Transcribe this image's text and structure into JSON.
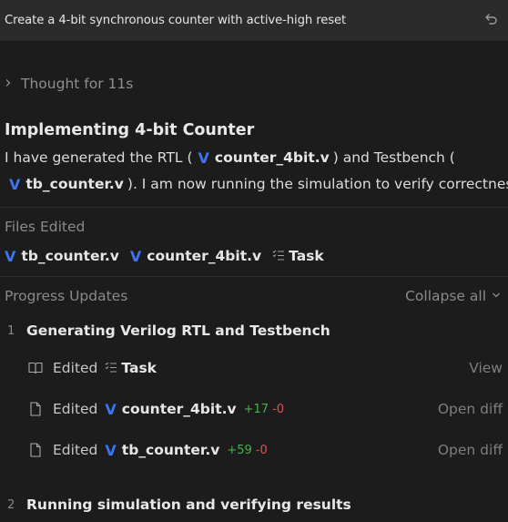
{
  "prompt": {
    "text": "Create a 4-bit synchronous counter with active-high reset"
  },
  "thought": {
    "label": "Thought for 11s"
  },
  "summary": {
    "title": "Implementing 4-bit Counter",
    "line1_prefix": "I have generated the RTL (",
    "line1_file": "counter_4bit.v",
    "line1_mid": ") and Testbench (",
    "line2_file": "tb_counter.v",
    "line2_suffix": "). I am now running the simulation to verify correctness."
  },
  "files_edited": {
    "title": "Files Edited",
    "items": [
      "tb_counter.v",
      "counter_4bit.v",
      "Task"
    ]
  },
  "progress": {
    "title": "Progress Updates",
    "collapse_label": "Collapse all",
    "steps": [
      {
        "number": "1",
        "label": "Generating Verilog RTL and Testbench",
        "actions": [
          {
            "verb": "Edited",
            "target": "Task",
            "link": "View"
          },
          {
            "verb": "Edited",
            "target": "counter_4bit.v",
            "added": "+17",
            "removed": "-0",
            "link": "Open diff"
          },
          {
            "verb": "Edited",
            "target": "tb_counter.v",
            "added": "+59",
            "removed": "-0",
            "link": "Open diff"
          }
        ]
      },
      {
        "number": "2",
        "label": "Running simulation and verifying results"
      }
    ]
  },
  "colors": {
    "background": "#1c1c1c",
    "prompt_bar": "#2b2b2b",
    "verilog_icon": "#3b76f0",
    "added": "#4caf50",
    "removed": "#e05252"
  },
  "icons": {
    "undo": "undo-icon",
    "verilog": "verilog-file-icon",
    "task": "checklist-icon",
    "book": "book-icon",
    "file": "file-icon"
  }
}
